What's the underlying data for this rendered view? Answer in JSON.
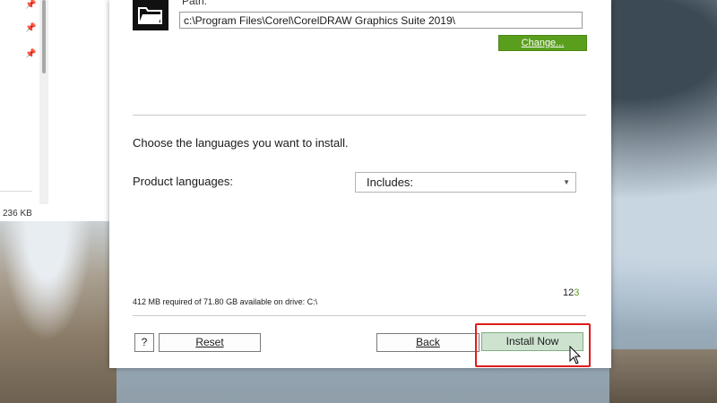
{
  "explorer": {
    "file_size": "236 KB"
  },
  "installer": {
    "path_label": "Path:",
    "path_value": "c:\\Program Files\\Corel\\CorelDRAW Graphics Suite 2019\\",
    "change_button": "Change...",
    "languages_intro": "Choose the languages you want to install.",
    "product_languages_label": "Product languages:",
    "product_languages_value": "Includes:",
    "space_info": "412 MB required of 71.80 GB available on drive: C:\\",
    "steps": {
      "done": "12",
      "current": "3"
    },
    "buttons": {
      "help": "?",
      "reset": "Reset",
      "back": "Back",
      "install": "Install Now"
    }
  },
  "colors": {
    "accent_green": "#5a9e1d",
    "install_button_bg": "#cde3cf",
    "highlight_red": "#e01b1b"
  },
  "icons": [
    "folder-icon",
    "pin-icon",
    "dropdown-arrow-icon",
    "mouse-cursor-icon"
  ]
}
